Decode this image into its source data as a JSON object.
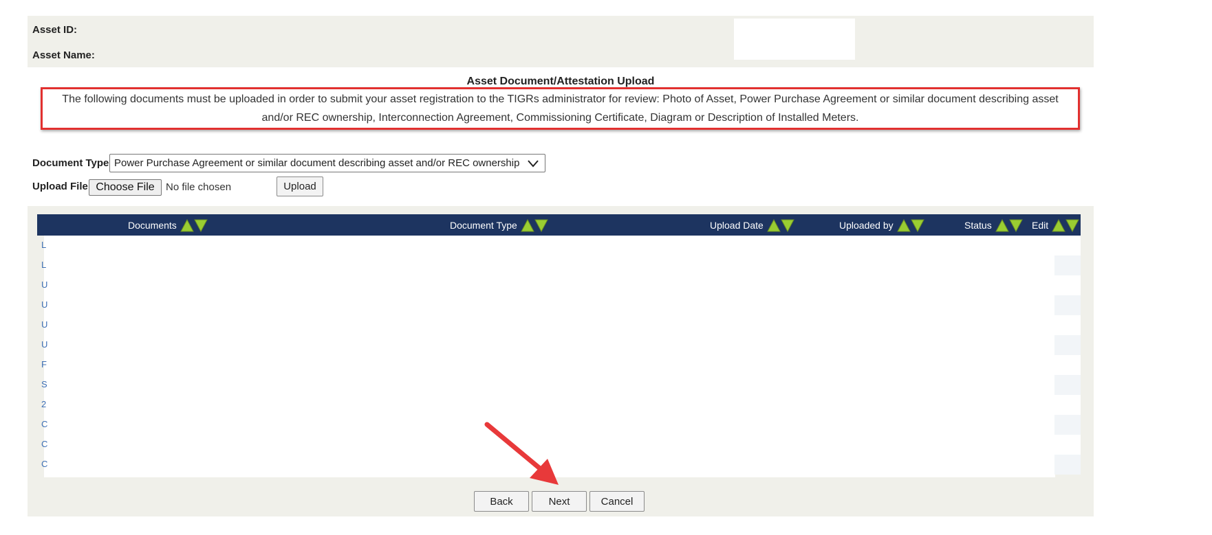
{
  "asset_info": {
    "asset_id_label": "Asset ID:",
    "asset_name_label": "Asset Name:"
  },
  "section": {
    "heading": "Asset Document/Attestation Upload",
    "notice": "The following documents must be uploaded in order to submit your asset registration to the TIGRs administrator for review: Photo of Asset, Power Purchase Agreement or similar document describing asset and/or REC ownership, Interconnection Agreement, Commissioning Certificate, Diagram or Description of Installed Meters."
  },
  "form": {
    "document_type_label": "Document Type:",
    "document_type_selected": "Power Purchase Agreement or similar document describing asset and/or REC ownership",
    "upload_file_label": "Upload File:",
    "choose_file_label": "Choose File",
    "no_file_text": "No file chosen",
    "upload_button": "Upload"
  },
  "grid": {
    "columns": [
      "Documents",
      "Document Type",
      "Upload Date",
      "Uploaded by",
      "Status",
      "Edit"
    ],
    "row_stubs": [
      "L",
      "L",
      "U",
      "U",
      "U",
      "U",
      "F",
      "S",
      "2",
      "C",
      "C",
      "C"
    ]
  },
  "buttons": {
    "back": "Back",
    "next": "Next",
    "cancel": "Cancel"
  },
  "colors": {
    "header_bg": "#1d3460",
    "panel_bg": "#f0f0ea",
    "notice_border": "#e2302f",
    "link": "#3d6fb5",
    "sort_arrow_green": "#9acd32",
    "annotation_arrow": "#e8393a"
  }
}
